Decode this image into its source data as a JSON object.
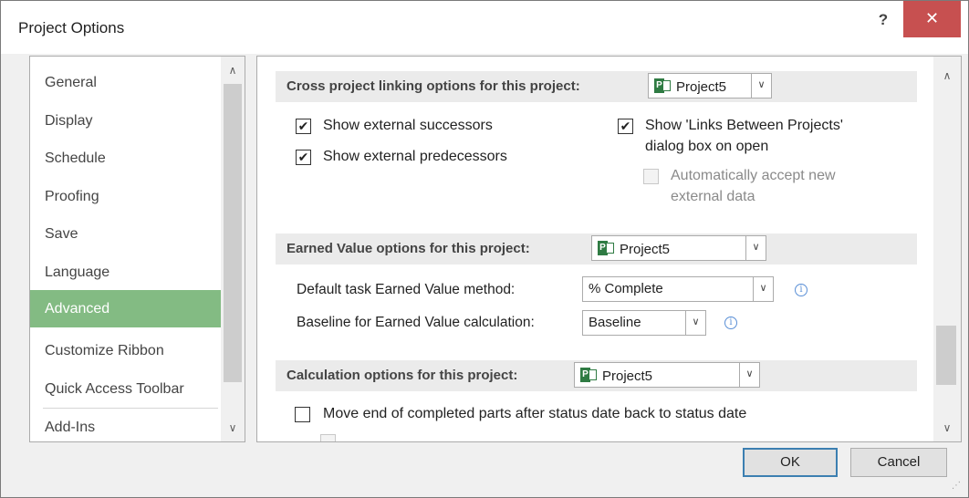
{
  "window": {
    "title": "Project Options",
    "help_label": "?",
    "close_label": "✕"
  },
  "nav": {
    "items": [
      {
        "label": "General"
      },
      {
        "label": "Display"
      },
      {
        "label": "Schedule"
      },
      {
        "label": "Proofing"
      },
      {
        "label": "Save"
      },
      {
        "label": "Language"
      },
      {
        "label": "Advanced",
        "selected": true
      },
      {
        "label": "Customize Ribbon"
      },
      {
        "label": "Quick Access Toolbar"
      },
      {
        "label": "Add-Ins"
      }
    ],
    "scroll_up": "∧",
    "scroll_down": "∨"
  },
  "main": {
    "scroll_up": "∧",
    "scroll_down": "∨",
    "cross_project": {
      "header": "Cross project linking options for this project:",
      "project_select": "Project5",
      "show_external_successors": {
        "label": "Show external successors",
        "checked": true
      },
      "show_external_predecessors": {
        "label": "Show external predecessors",
        "checked": true
      },
      "show_links_between_projects": {
        "label_line1": "Show 'Links Between Projects'",
        "label_line2": "dialog box on open",
        "checked": true
      },
      "auto_accept": {
        "label_line1": "Automatically accept new",
        "label_line2": "external data",
        "checked": false,
        "disabled": true
      }
    },
    "earned_value": {
      "header": "Earned Value options for this project:",
      "project_select": "Project5",
      "default_method_label": "Default task Earned Value method:",
      "default_method_value": "% Complete",
      "baseline_label": "Baseline for Earned Value calculation:",
      "baseline_value": "Baseline"
    },
    "calculation": {
      "header": "Calculation options for this project:",
      "project_select": "Project5",
      "move_end_label": "Move end of completed parts after status date back to status date",
      "move_end_checked": false
    }
  },
  "footer": {
    "ok_label": "OK",
    "cancel_label": "Cancel"
  },
  "icons": {
    "check": "✔",
    "dropdown": "∨",
    "info": "i",
    "project_icon_letter": "P"
  },
  "colors": {
    "selected_nav": "#83bb83",
    "close_button": "#c75050",
    "project_icon": "#2f7b43"
  }
}
